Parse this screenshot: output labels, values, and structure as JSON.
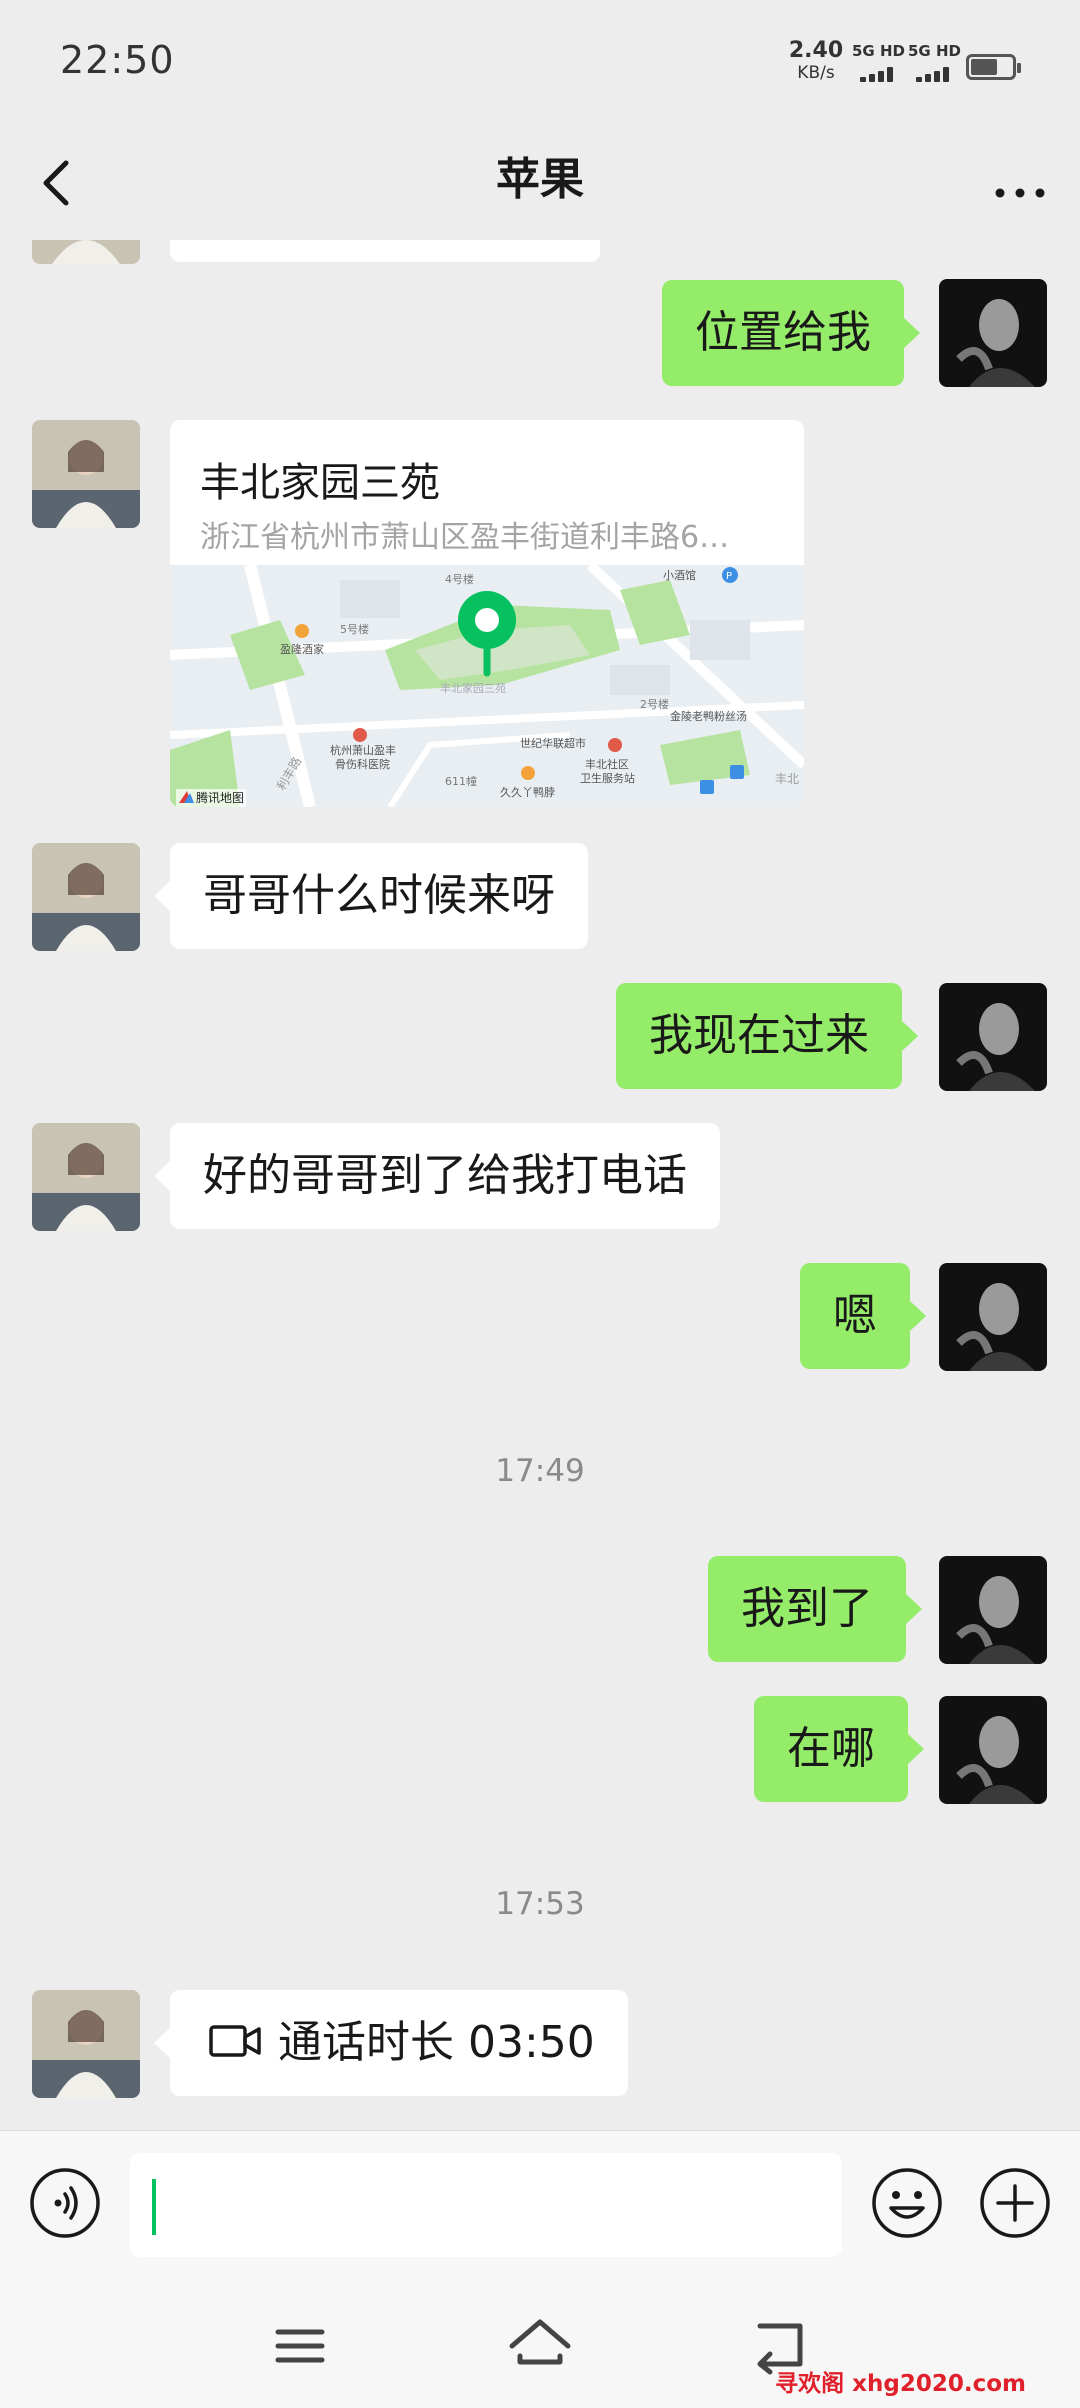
{
  "status_bar": {
    "time": "22:50",
    "net_speed_value": "2.40",
    "net_speed_unit": "KB/s",
    "signal_1": "5G HD",
    "signal_2": "5G HD"
  },
  "nav": {
    "title": "苹果",
    "more_label": "···"
  },
  "messages": [
    {
      "from": "me",
      "text": "位置给我"
    },
    {
      "from": "them",
      "type": "location",
      "name": "丰北家园三苑",
      "address": "浙江省杭州市萧山区盈丰街道利丰路6…"
    },
    {
      "from": "them",
      "text": "哥哥什么时候来呀"
    },
    {
      "from": "me",
      "text": "我现在过来"
    },
    {
      "from": "them",
      "text": "好的哥哥到了给我打电话"
    },
    {
      "from": "me",
      "text": "嗯"
    },
    {
      "type": "timestamp",
      "text": "17:49"
    },
    {
      "from": "me",
      "text": "我到了"
    },
    {
      "from": "me",
      "text": "在哪"
    },
    {
      "type": "timestamp",
      "text": "17:53"
    },
    {
      "from": "them",
      "type": "video_call",
      "text": "通话时长 03:50"
    }
  ],
  "map": {
    "labels": {
      "building_4": "4号楼",
      "building_5": "5号楼",
      "restaurant": "盈隆酒家",
      "bar": "小酒馆",
      "community": "丰北家园三苑",
      "building_2": "2号楼",
      "duck_shop": "金陵老鸭粉丝汤",
      "hospital_1": "杭州萧山盈丰",
      "hospital_2": "骨伤科医院",
      "supermarket": "世纪华联超市",
      "health_1": "丰北社区",
      "health_2": "卫生服务站",
      "building_611": "611幢",
      "duck_shop_2": "久久丫鸭脖",
      "road": "利丰路",
      "road_partial": "丰北",
      "provider": "腾讯地图",
      "poi_p": "P"
    },
    "colors": {
      "pin": "#07c160",
      "green_area": "#b6e4a0",
      "road": "#ffffff",
      "base": "#e9eef2"
    }
  },
  "watermark": "寻欢阁 xhg2020.com",
  "colors": {
    "my_bubble": "#95ec69",
    "their_bubble": "#ffffff",
    "background": "#ededed",
    "accent": "#07c160"
  }
}
